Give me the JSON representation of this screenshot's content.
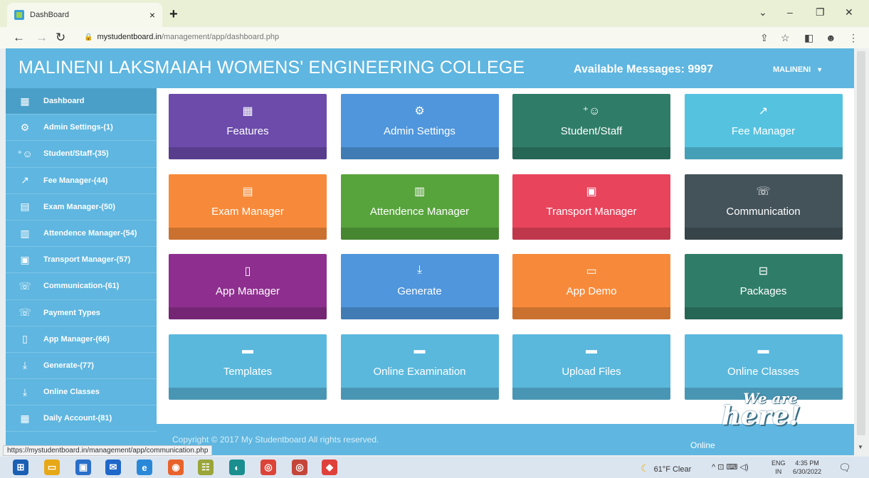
{
  "browser": {
    "tab_title": "DashBoard",
    "tab_close": "×",
    "new_tab": "+",
    "url_host": "mystudentboard.in",
    "url_path": "/management/app/dashboard.php",
    "status_url": "https://mystudentboard.in/management/app/communication.php",
    "controls": {
      "dropdown": "⌄",
      "minimize": "–",
      "restore": "❐",
      "close": "✕"
    },
    "nav": {
      "back": "←",
      "forward": "→",
      "reload": "↻"
    },
    "addr_icons": {
      "share": "⇪",
      "star": "☆",
      "sidepanel": "◧",
      "profile": "☻",
      "menu": "⋮"
    }
  },
  "header": {
    "college_name": "MALINENI LAKSMAIAH WOMENS' ENGINEERING COLLEGE",
    "messages": "Available Messages: 9997",
    "user": "MALINENI",
    "caret": "▾"
  },
  "sidebar": {
    "items": [
      {
        "label": "Dashboard",
        "icon": "▦"
      },
      {
        "label": "Admin Settings-(1)",
        "icon": "⚙"
      },
      {
        "label": "Student/Staff-(35)",
        "icon": "⁺☺"
      },
      {
        "label": "Fee Manager-(44)",
        "icon": "↗"
      },
      {
        "label": "Exam Manager-(50)",
        "icon": "▤"
      },
      {
        "label": "Attendence Manager-(54)",
        "icon": "▥"
      },
      {
        "label": "Transport Manager-(57)",
        "icon": "▣"
      },
      {
        "label": "Communication-(61)",
        "icon": "☏"
      },
      {
        "label": "Payment Types",
        "icon": "☏"
      },
      {
        "label": "App Manager-(66)",
        "icon": "▯"
      },
      {
        "label": "Generate-(77)",
        "icon": "⤓"
      },
      {
        "label": "Online Classes",
        "icon": "⤓"
      },
      {
        "label": "Daily Account-(81)",
        "icon": "▦"
      }
    ]
  },
  "tiles": [
    {
      "label": "Features",
      "icon": "▦",
      "color": "#6c4bab"
    },
    {
      "label": "Admin Settings",
      "icon": "⚙",
      "color": "#4f96dc"
    },
    {
      "label": "Student/Staff",
      "icon": "⁺☺",
      "color": "#2f7d68"
    },
    {
      "label": "Fee Manager",
      "icon": "↗",
      "color": "#55c3e0"
    },
    {
      "label": "Exam Manager",
      "icon": "▤",
      "color": "#f78a3a"
    },
    {
      "label": "Attendence Manager",
      "icon": "▥",
      "color": "#57a43c"
    },
    {
      "label": "Transport Manager",
      "icon": "▣",
      "color": "#e8445c"
    },
    {
      "label": "Communication",
      "icon": "☏",
      "color": "#44535a"
    },
    {
      "label": "App Manager",
      "icon": "▯",
      "color": "#8e2f8f"
    },
    {
      "label": "Generate",
      "icon": "⤓",
      "color": "#4f96dc"
    },
    {
      "label": "App Demo",
      "icon": "▭",
      "color": "#f78a3a"
    },
    {
      "label": "Packages",
      "icon": "⊟",
      "color": "#2f7d68"
    },
    {
      "label": "Templates",
      "icon": "▬",
      "color": "#5ab8dc"
    },
    {
      "label": "Online Examination",
      "icon": "▬",
      "color": "#5ab8dc"
    },
    {
      "label": "Upload Files",
      "icon": "▬",
      "color": "#5ab8dc"
    },
    {
      "label": "Online Classes",
      "icon": "▬",
      "color": "#5ab8dc"
    }
  ],
  "footer": {
    "copyright": "Copyright © 2017 My Studentboard All rights reserved.",
    "online": "Online"
  },
  "chat_badge": {
    "line1": "We are",
    "line2": "here!"
  },
  "taskbar": {
    "weather": "61°F Clear",
    "tray": "^ ⊡ ⌨ ◁)",
    "lang1": "ENG",
    "lang2": "IN",
    "time": "4:35 PM",
    "date": "6/30/2022",
    "notify": "🗨",
    "apps": [
      {
        "name": "start-icon",
        "glyph": "⊞",
        "color": "#1a5fb4"
      },
      {
        "name": "file-explorer-icon",
        "glyph": "▭",
        "color": "#e6a817"
      },
      {
        "name": "store-icon",
        "glyph": "▣",
        "color": "#2a6fc9"
      },
      {
        "name": "mail-icon",
        "glyph": "✉",
        "color": "#1f68c9"
      },
      {
        "name": "ie-icon",
        "glyph": "e",
        "color": "#2a88d8"
      },
      {
        "name": "firefox-icon",
        "glyph": "◉",
        "color": "#e8632b"
      },
      {
        "name": "app-icon",
        "glyph": "☷",
        "color": "#9aa53a"
      },
      {
        "name": "edge-icon",
        "glyph": "◐",
        "color": "#1b8f8f"
      },
      {
        "name": "chrome-icon",
        "glyph": "◎",
        "color": "#db4437"
      },
      {
        "name": "chrome-profile-icon",
        "glyph": "◎",
        "color": "#c4453a"
      },
      {
        "name": "anydesk-icon",
        "glyph": "◆",
        "color": "#e0403a"
      }
    ]
  }
}
